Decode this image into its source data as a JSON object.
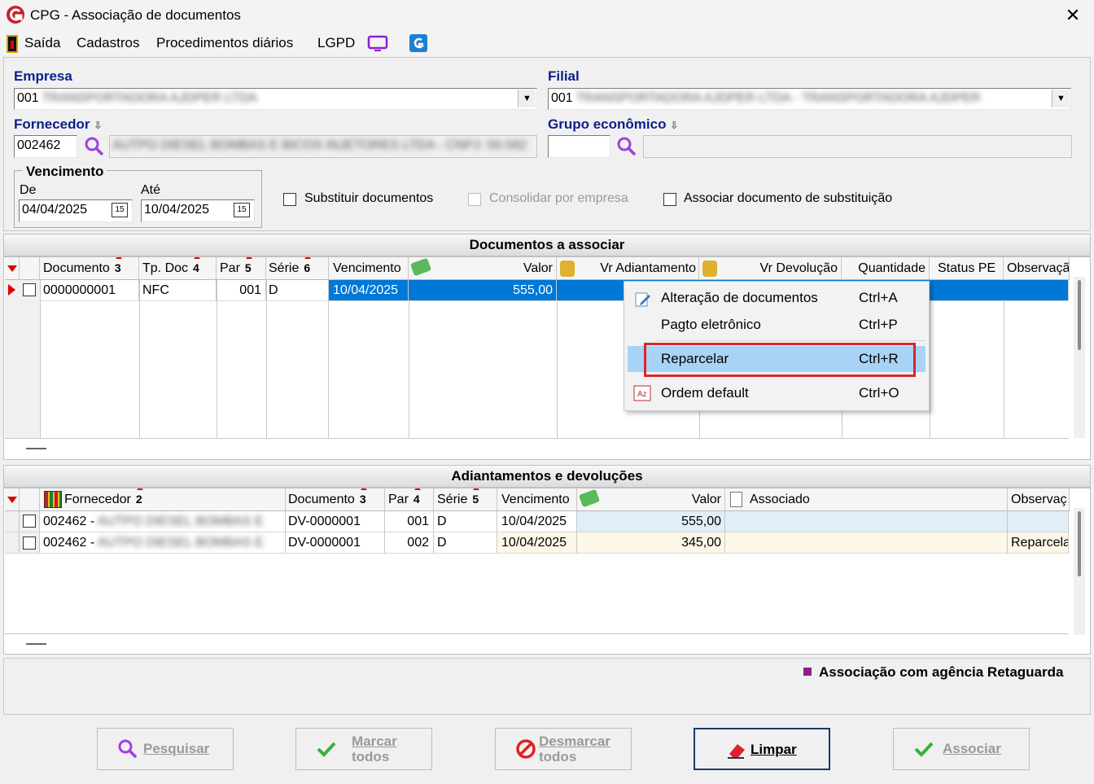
{
  "window": {
    "title": "CPG - Associação de documentos",
    "close": "✕"
  },
  "menu": [
    "Saída",
    "Cadastros",
    "Procedimentos diários",
    "LGPD"
  ],
  "form": {
    "empresa_label": "Empresa",
    "empresa_value": "001",
    "empresa_name": "TRANSPORTADORA AJDPER LTDA",
    "filial_label": "Filial",
    "filial_value": "001",
    "filial_name": "TRANSPORTADORA AJDPER LTDA - TRANSPORTADORA AJDPER",
    "fornecedor_label": "Fornecedor",
    "fornecedor_value": "002462",
    "fornecedor_name": "AUTPO DIESEL BOMBAS E BICOS INJETORES LTDA - CNPJ: 59.582",
    "grupo_label": "Grupo econômico",
    "grupo_value": "",
    "vencimento_label": "Vencimento",
    "de_label": "De",
    "de_value": "04/04/2025",
    "ate_label": "Até",
    "ate_value": "10/04/2025",
    "cal_icon": "15",
    "chk_substituir": "Substituir documentos",
    "chk_consolidar": "Consolidar por empresa",
    "chk_associar": "Associar documento de substituição"
  },
  "docs": {
    "title": "Documentos a associar",
    "headers": {
      "documento": "Documento",
      "documento_sort": "3",
      "tpdoc": "Tp. Doc",
      "tpdoc_sort": "4",
      "par": "Par",
      "par_sort": "5",
      "serie": "Série",
      "serie_sort": "6",
      "vencimento": "Vencimento",
      "valor": "Valor",
      "vr_adiant": "Vr Adiantamento",
      "vr_devol": "Vr Devolução",
      "quantidade": "Quantidade",
      "status": "Status PE",
      "obs": "Observaçã"
    },
    "row": {
      "documento": "0000000001",
      "tpdoc": "NFC",
      "par": "001",
      "serie": "D",
      "vencimento": "10/04/2025",
      "valor": "555,00"
    }
  },
  "context_menu": [
    {
      "label": "Alteração de documentos",
      "key": "Ctrl+A",
      "icon": "edit-icon"
    },
    {
      "label": "Pagto eletrônico",
      "key": "Ctrl+P",
      "icon": ""
    },
    {
      "label": "Reparcelar",
      "key": "Ctrl+R",
      "icon": ""
    },
    {
      "label": "Ordem default",
      "key": "Ctrl+O",
      "icon": "sort-az-icon"
    }
  ],
  "adiant": {
    "title": "Adiantamentos e devoluções",
    "headers": {
      "fornecedor": "Fornecedor",
      "fornecedor_sort": "2",
      "documento": "Documento",
      "documento_sort": "3",
      "par": "Par",
      "par_sort": "4",
      "serie": "Série",
      "serie_sort": "5",
      "vencimento": "Vencimento",
      "valor": "Valor",
      "associado": "Associado",
      "obs": "Observaç"
    },
    "rows": [
      {
        "fornecedor": "002462 -",
        "fornecedor_name": "AUTPO DIESEL BOMBAS E",
        "documento": "DV-0000001",
        "par": "001",
        "serie": "D",
        "vencimento": "10/04/2025",
        "valor": "555,00",
        "obs": ""
      },
      {
        "fornecedor": "002462 -",
        "fornecedor_name": "AUTPO DIESEL BOMBAS E",
        "documento": "DV-0000001",
        "par": "002",
        "serie": "D",
        "vencimento": "10/04/2025",
        "valor": "345,00",
        "obs": "Reparcela"
      }
    ]
  },
  "legend": "Associação com agência Retaguarda",
  "buttons": {
    "pesquisar": "Pesquisar",
    "marcar1": "Marcar",
    "marcar2": "todos",
    "desmarcar1": "Desmarcar",
    "desmarcar2": "todos",
    "limpar": "Limpar",
    "associar": "Associar"
  },
  "colors": {
    "accent_blue": "#0b1f8c",
    "selection": "#0078d7",
    "highlight": "#cce8ff",
    "red_box": "#d9262c",
    "legend": "#8a1f8a"
  }
}
